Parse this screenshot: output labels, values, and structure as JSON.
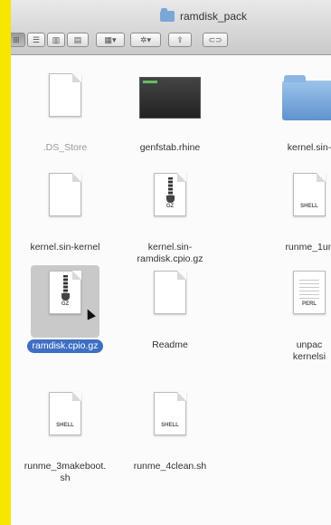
{
  "window": {
    "title": "ramdisk_pack"
  },
  "toolbar": {
    "view_icons": [
      "icon-view-icon",
      "list-view-icon",
      "column-view-icon",
      "coverflow-view-icon"
    ],
    "arrange_icon": "arrange-menu-icon",
    "action_icon": "gear-icon",
    "share_icon": "share-icon",
    "edit_tags_icon": "edit-tags-icon",
    "dropdown_arrow": "▾"
  },
  "files": [
    {
      "name": ".DS_Store",
      "icon": "blank-document-icon",
      "hidden": true,
      "tag": ""
    },
    {
      "name": "genfstab.rhine",
      "icon": "terminal-executable-icon",
      "tag": ""
    },
    {
      "name": "kernel.sin-",
      "icon": "folder-icon",
      "tag": ""
    },
    {
      "name": "kernel.sin-kernel",
      "icon": "blank-document-icon",
      "tag": ""
    },
    {
      "name": "kernel.sin-\nramdisk.cpio.gz",
      "icon": "gzip-archive-icon",
      "tag": "GZ"
    },
    {
      "name": "runme_1un",
      "icon": "shell-script-icon",
      "tag": "SHELL"
    },
    {
      "name": "ramdisk.cpio.gz",
      "icon": "gzip-archive-icon",
      "tag": "GZ",
      "selected": true
    },
    {
      "name": "Readme",
      "icon": "blank-document-icon",
      "tag": ""
    },
    {
      "name": "unpac\nkernelsi",
      "icon": "perl-script-icon",
      "tag": "PERL"
    },
    {
      "name": "runme_3makeboot.\nsh",
      "icon": "shell-script-icon",
      "tag": "SHELL"
    },
    {
      "name": "runme_4clean.sh",
      "icon": "shell-script-icon",
      "tag": "SHELL"
    }
  ],
  "colors": {
    "selection": "#3e6fc4",
    "background_outside": "#f7e600"
  }
}
